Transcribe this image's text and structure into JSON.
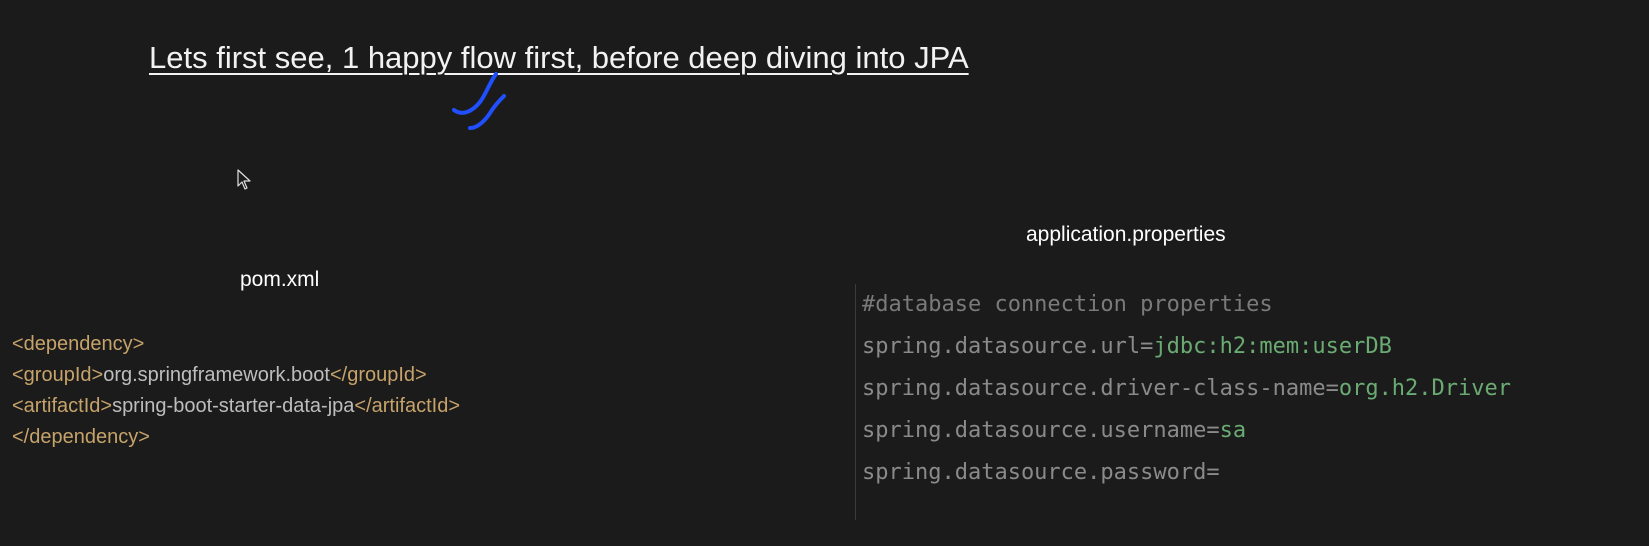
{
  "slide": {
    "title": "Lets first see, 1 happy flow first, before deep diving into JPA",
    "pom_label": "pom.xml",
    "props_label": "application.properties"
  },
  "pom": {
    "line1": "<dependency>",
    "line2_open": "<groupId>",
    "line2_value": "org.springframework.boot",
    "line2_close": "</groupId>",
    "line3_open": "<artifactId>",
    "line3_value": "spring-boot-starter-data-jpa",
    "line3_close": "</artifactId>",
    "line4": "</dependency>"
  },
  "properties": {
    "comment": "#database connection properties",
    "url_key": "spring.datasource.url=",
    "url_value": "jdbc:h2:mem:userDB",
    "driver_key": "spring.datasource.driver-class-name=",
    "driver_value": "org.h2.Driver",
    "username_key": "spring.datasource.username=",
    "username_value": "sa",
    "password_key": "spring.datasource.password="
  },
  "colors": {
    "background": "#1b1b1b",
    "xml_tag": "#c6a36a",
    "property_value": "#6aab73",
    "annotation_ink": "#1f4fff"
  }
}
